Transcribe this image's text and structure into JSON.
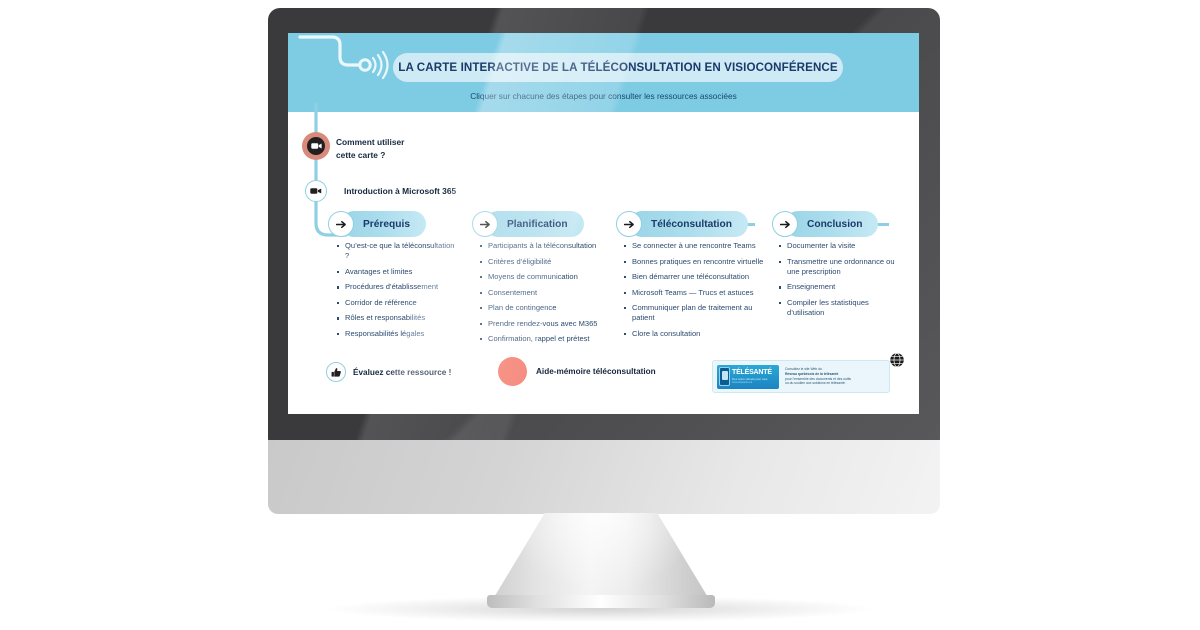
{
  "colors": {
    "banner_bg": "#7ecbe4",
    "pill_gradient_start": "#9ad5e8",
    "pill_gradient_end": "#c5e9f4",
    "line": "#8fcfe3",
    "title_navy": "#1b3a6b",
    "body_text": "#2b4a6f",
    "coral": "#f4796a",
    "howto_ring": "#d98a7b",
    "bezel": "#3a3a3c",
    "logo_blue": "#1c84c0"
  },
  "header": {
    "title": "LA CARTE INTERACTIVE DE LA TÉLÉCONSULTATION EN VISIOCONFÉRENCE",
    "subtitle": "Cliquer sur chacune des étapes pour consulter les ressources associées",
    "signal_icon": "wifi-signal-icon"
  },
  "rail": {
    "items": [
      {
        "label_line1": "Comment utiliser",
        "label_line2": "cette carte ?",
        "icon": "video-camera-icon",
        "highlighted": true
      },
      {
        "label_line1": "Introduction à Microsoft 365",
        "label_line2": "",
        "icon": "video-camera-icon",
        "highlighted": false
      }
    ]
  },
  "steps": [
    {
      "label": "Prérequis",
      "icon": "arrow-right-icon",
      "items": [
        "Qu’est-ce que la téléconsultation ?",
        "Avantages et limites",
        "Procédures d’établissement",
        "Corridor de référence",
        "Rôles et responsabilités",
        "Responsabilités légales"
      ]
    },
    {
      "label": "Planification",
      "icon": "arrow-right-icon",
      "items": [
        "Participants à la téléconsultation",
        "Critères d’éligibilité",
        "Moyens de communication",
        "Consentement",
        "Plan de contingence",
        "Prendre rendez-vous avec M365",
        "Confirmation, rappel et prétest"
      ]
    },
    {
      "label": "Téléconsultation",
      "icon": "arrow-right-icon",
      "items": [
        "Se connecter à une rencontre Teams",
        "Bonnes pratiques en rencontre virtuelle",
        "Bien démarrer une téléconsultation",
        "Microsoft Teams — Trucs et astuces",
        "Communiquer plan de traitement au patient",
        "Clore la consultation"
      ]
    },
    {
      "label": "Conclusion",
      "icon": "arrow-right-icon",
      "items": [
        "Documenter la visite",
        "Transmettre une ordonnance ou une prescription",
        "Enseignement",
        "Compiler les statistiques d’utilisation"
      ]
    }
  ],
  "footer": {
    "rate": {
      "label": "Évaluez cette ressource !",
      "icon": "thumbs-up-icon"
    },
    "aide": {
      "label": "Aide-mémoire téléconsultation",
      "icon": "coral-circle-icon"
    },
    "logo": {
      "wordmark": "TÉLÉSANTÉ",
      "wordmark_sub": "Des soins virtuels pour tous",
      "wordmark_url": "www.telesante.ca",
      "blurb_line1": "Consultez le site Web du",
      "blurb_line2": "Réseau québécois de la télésanté",
      "blurb_line3": "pour l’ensemble des documents et des outils",
      "blurb_line4": "ou du soutien aux solutions en télésanté.",
      "globe_icon": "globe-icon",
      "phone_icon": "mobile-phone-icon"
    }
  }
}
